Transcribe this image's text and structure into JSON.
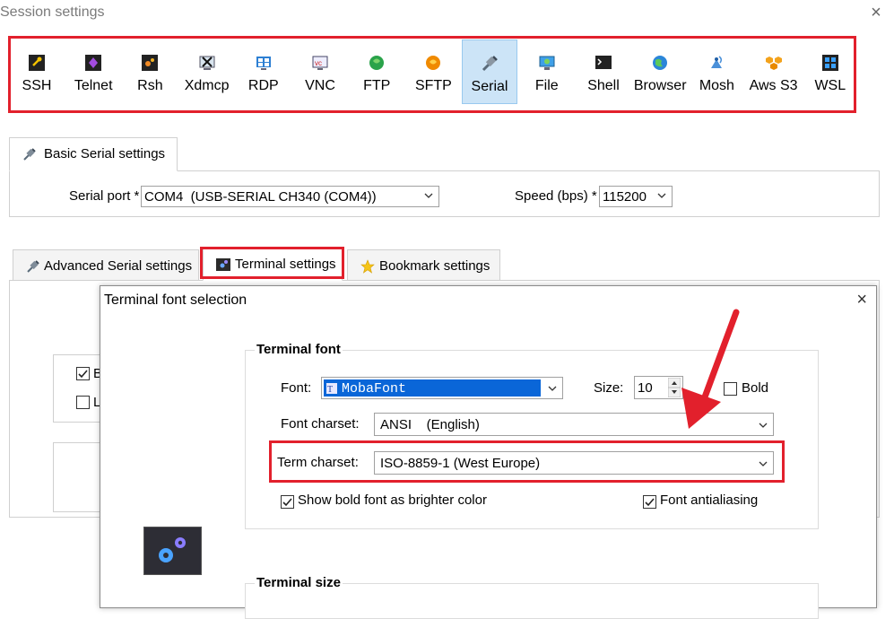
{
  "window": {
    "title": "Session settings",
    "close_label": "×"
  },
  "protocols": [
    {
      "label": "SSH",
      "icon": "key-icon"
    },
    {
      "label": "Telnet",
      "icon": "telnet-icon"
    },
    {
      "label": "Rsh",
      "icon": "rsh-icon"
    },
    {
      "label": "Xdmcp",
      "icon": "xdmcp-icon"
    },
    {
      "label": "RDP",
      "icon": "rdp-icon"
    },
    {
      "label": "VNC",
      "icon": "vnc-icon"
    },
    {
      "label": "FTP",
      "icon": "ftp-icon"
    },
    {
      "label": "SFTP",
      "icon": "sftp-icon"
    },
    {
      "label": "Serial",
      "icon": "serial-plug-icon",
      "selected": true
    },
    {
      "label": "File",
      "icon": "file-icon"
    },
    {
      "label": "Shell",
      "icon": "shell-icon"
    },
    {
      "label": "Browser",
      "icon": "browser-icon"
    },
    {
      "label": "Mosh",
      "icon": "mosh-icon"
    },
    {
      "label": "Aws S3",
      "icon": "aws-s3-icon"
    },
    {
      "label": "WSL",
      "icon": "wsl-icon"
    }
  ],
  "basic": {
    "tab_label": "Basic Serial settings",
    "serial_port_label": "Serial port *",
    "serial_port_value": "COM4  (USB-SERIAL CH340 (COM4))",
    "speed_label": "Speed (bps) *",
    "speed_value": "115200"
  },
  "tabs": {
    "advanced": "Advanced Serial settings",
    "terminal": "Terminal settings",
    "bookmark": "Bookmark settings"
  },
  "behind": {
    "check1": "B",
    "check2": "L"
  },
  "dialog": {
    "title": "Terminal font selection",
    "close_label": "×",
    "font_group": "Terminal font",
    "font_label": "Font:",
    "font_value": "MobaFont",
    "size_label": "Size:",
    "size_value": "10",
    "bold_label": "Bold",
    "charset_label": "Font charset:",
    "charset_value": "ANSI    (English)",
    "term_charset_label": "Term charset:",
    "term_charset_value": "ISO-8859-1 (West Europe)",
    "bold_bright_label": "Show bold font as brighter color",
    "antialias_label": "Font antialiasing",
    "size_group": "Terminal size"
  },
  "colors": {
    "highlight": "#e2202c",
    "selection": "#cce4f7",
    "accent": "#0a66d8"
  }
}
